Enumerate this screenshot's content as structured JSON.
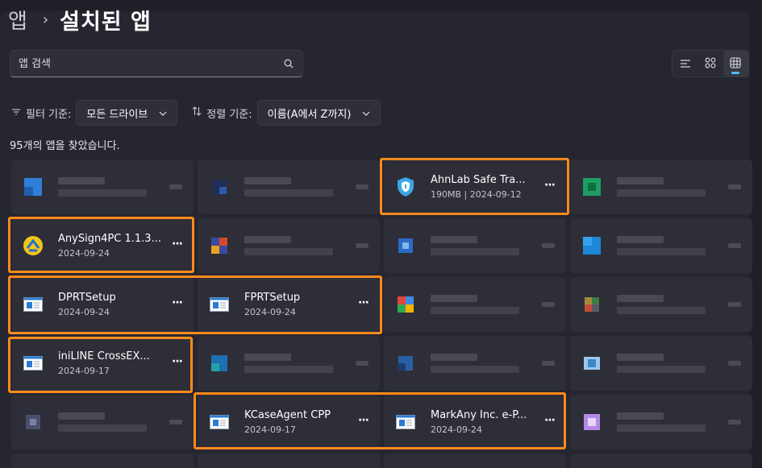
{
  "breadcrumb": {
    "root": "앱",
    "separator": "›",
    "current": "설치된 앱"
  },
  "search": {
    "placeholder": "앱 검색",
    "icon": "search-icon"
  },
  "view_toggle": {
    "options": [
      "list",
      "grid-small",
      "grid-large"
    ],
    "selected": "grid-large"
  },
  "filters": {
    "filter_label": "필터 기준:",
    "filter_value": "모든 드라이브",
    "sort_label": "정렬 기준:",
    "sort_value": "이름(A에서 Z까지)"
  },
  "result_count": "95개의 앱을 찾았습니다.",
  "colors": {
    "highlight": "#ff8a1c",
    "accent": "#4cc2ff"
  },
  "apps": [
    {
      "name": "AhnLab Safe Tra...",
      "meta": "190MB  |  2024-09-12",
      "icon": "shield-icon"
    },
    {
      "name": "AnySign4PC 1.1.3...",
      "meta": "2024-09-24",
      "icon": "anysign-logo-icon"
    },
    {
      "name": "DPRTSetup",
      "meta": "2024-09-24",
      "icon": "installer-window-icon"
    },
    {
      "name": "FPRTSetup",
      "meta": "2024-09-24",
      "icon": "installer-window-icon"
    },
    {
      "name": "iniLINE CrossEX...",
      "meta": "2024-09-17",
      "icon": "installer-window-icon"
    },
    {
      "name": "KCaseAgent CPP",
      "meta": "2024-09-17",
      "icon": "installer-window-icon"
    },
    {
      "name": "MarkAny Inc. e-P...",
      "meta": "2024-09-24",
      "icon": "installer-window-icon"
    }
  ],
  "more_label": "···"
}
